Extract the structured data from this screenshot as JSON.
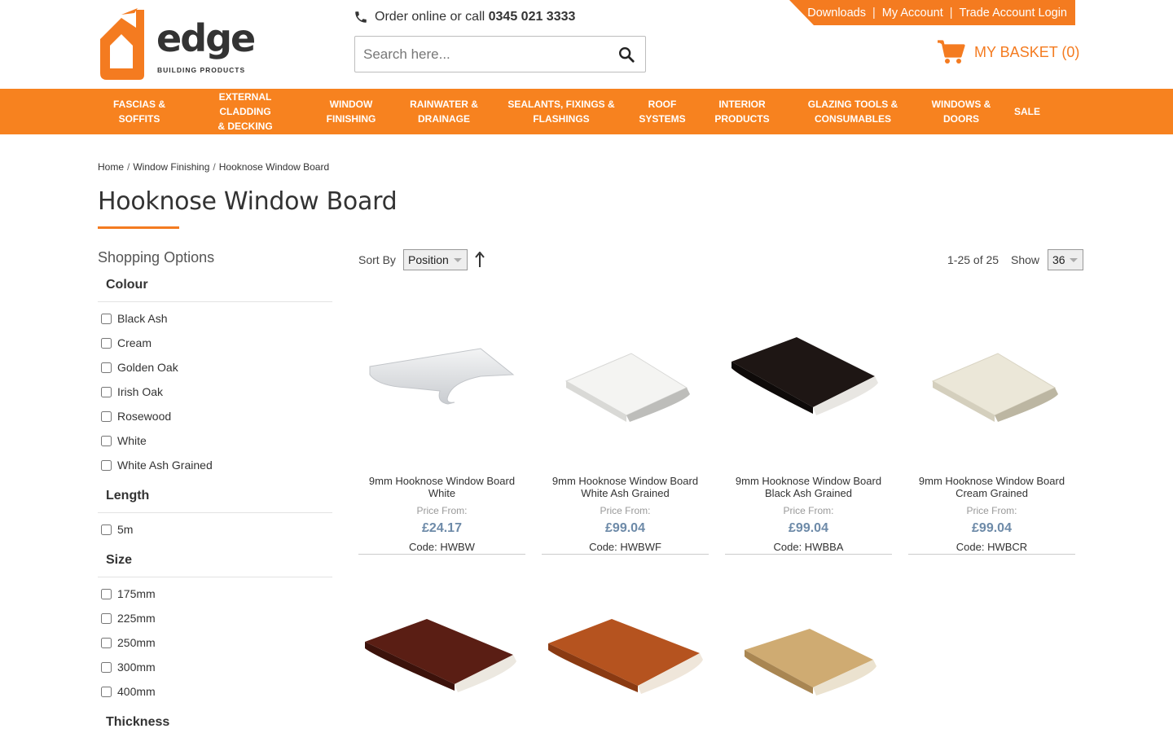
{
  "brand": {
    "name": "edge",
    "tagline": "BUILDING PRODUCTS",
    "accent": "#f47b20"
  },
  "header": {
    "order_text": "Order online or call ",
    "phone": "0345 021 3333",
    "phone_icon": "phone-icon",
    "search_placeholder": "Search here...",
    "search_icon": "search-icon",
    "top_links": [
      "Downloads",
      "My Account",
      "Trade Account Login"
    ],
    "basket_label": "MY BASKET (0)",
    "basket_icon": "cart-icon"
  },
  "nav": {
    "items": [
      "FASCIAS &\nSOFFITS",
      "EXTERNAL CLADDING\n& DECKING",
      "WINDOW\nFINISHING",
      "RAINWATER &\nDRAINAGE",
      "SEALANTS, FIXINGS &\nFLASHINGS",
      "ROOF\nSYSTEMS",
      "INTERIOR\nPRODUCTS",
      "GLAZING TOOLS &\nCONSUMABLES",
      "WINDOWS &\nDOORS",
      "SALE"
    ]
  },
  "breadcrumb": [
    "Home",
    "Window Finishing",
    "Hooknose Window Board"
  ],
  "page_title": "Hooknose Window Board",
  "sidebar": {
    "title": "Shopping Options",
    "filters": [
      {
        "name": "Colour",
        "options": [
          "Black Ash",
          "Cream",
          "Golden Oak",
          "Irish Oak",
          "Rosewood",
          "White",
          "White Ash Grained"
        ]
      },
      {
        "name": "Length",
        "options": [
          "5m"
        ]
      },
      {
        "name": "Size",
        "options": [
          "175mm",
          "225mm",
          "250mm",
          "300mm",
          "400mm"
        ]
      },
      {
        "name": "Thickness",
        "options": []
      }
    ]
  },
  "toolbar": {
    "sort_label": "Sort By",
    "sort_value": "Position",
    "sort_direction_icon": "sort-arrow-up-icon",
    "count_text": "1-25 of 25",
    "show_label": "Show",
    "show_value": "36"
  },
  "products": [
    {
      "name": "9mm Hooknose Window Board White",
      "price_label": "Price From:",
      "price": "£24.17",
      "code": "Code: HWBW",
      "swatch": "#e6e8ea"
    },
    {
      "name": "9mm Hooknose Window Board White Ash Grained",
      "price_label": "Price From:",
      "price": "£99.04",
      "code": "Code: HWBWF",
      "swatch": "#efefed"
    },
    {
      "name": "9mm Hooknose Window Board Black Ash Grained",
      "price_label": "Price From:",
      "price": "£99.04",
      "code": "Code: HWBBA",
      "swatch": "#1e1614"
    },
    {
      "name": "9mm Hooknose Window Board Cream Grained",
      "price_label": "Price From:",
      "price": "£99.04",
      "code": "Code: HWBCR",
      "swatch": "#ebe7d8"
    },
    {
      "name": "",
      "price_label": "",
      "price": "",
      "code": "",
      "swatch": "#5a1e14"
    },
    {
      "name": "",
      "price_label": "",
      "price": "",
      "code": "",
      "swatch": "#b5531f"
    },
    {
      "name": "",
      "price_label": "",
      "price": "",
      "code": "",
      "swatch": "#cfab72"
    }
  ]
}
